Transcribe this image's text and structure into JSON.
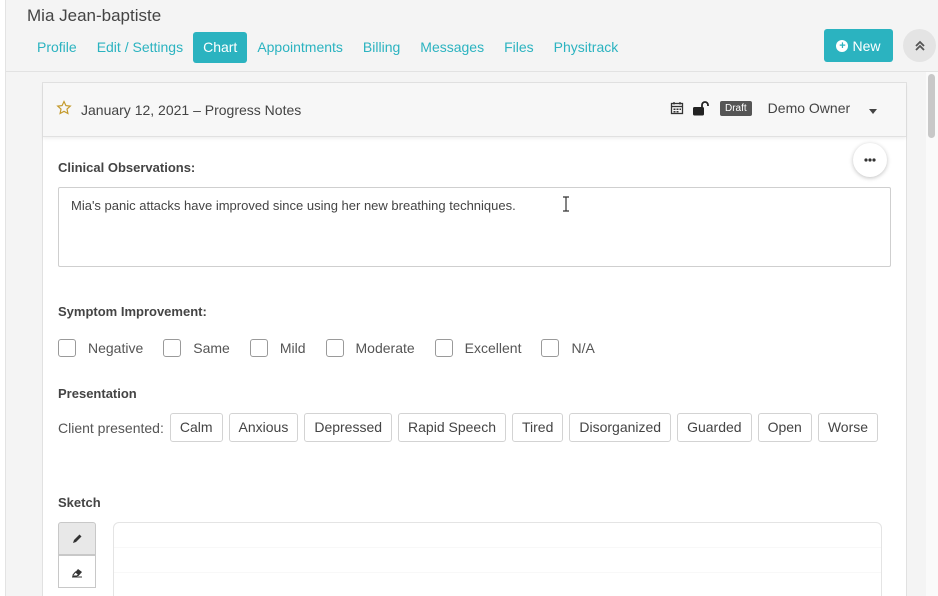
{
  "patient": {
    "name": "Mia Jean-baptiste"
  },
  "nav": {
    "tabs": [
      {
        "label": "Profile"
      },
      {
        "label": "Edit / Settings"
      },
      {
        "label": "Chart",
        "active": true
      },
      {
        "label": "Appointments"
      },
      {
        "label": "Billing"
      },
      {
        "label": "Messages"
      },
      {
        "label": "Files"
      },
      {
        "label": "Physitrack"
      }
    ],
    "new_label": "New"
  },
  "note": {
    "title": "January 12, 2021 – Progress Notes",
    "status": "Draft",
    "owner": "Demo Owner",
    "icons": [
      "star-icon",
      "calendar-icon",
      "unlock-icon",
      "chevron-down-icon"
    ]
  },
  "clinical": {
    "label": "Clinical Observations:",
    "value": "Mia's panic attacks have improved since using her new breathing techniques."
  },
  "symptom": {
    "label": "Symptom Improvement:",
    "options": [
      "Negative",
      "Same",
      "Mild",
      "Moderate",
      "Excellent",
      "N/A"
    ]
  },
  "presentation": {
    "label": "Presentation",
    "row_label": "Client presented:",
    "options": [
      "Calm",
      "Anxious",
      "Depressed",
      "Rapid Speech",
      "Tired",
      "Disorganized",
      "Guarded",
      "Open",
      "Worse"
    ]
  },
  "sketch": {
    "label": "Sketch",
    "tools": [
      "pencil-icon",
      "eraser-icon"
    ]
  },
  "colors": {
    "accent": "#2bb3c0",
    "badge": "#555555",
    "background": "#f4f4f4"
  }
}
